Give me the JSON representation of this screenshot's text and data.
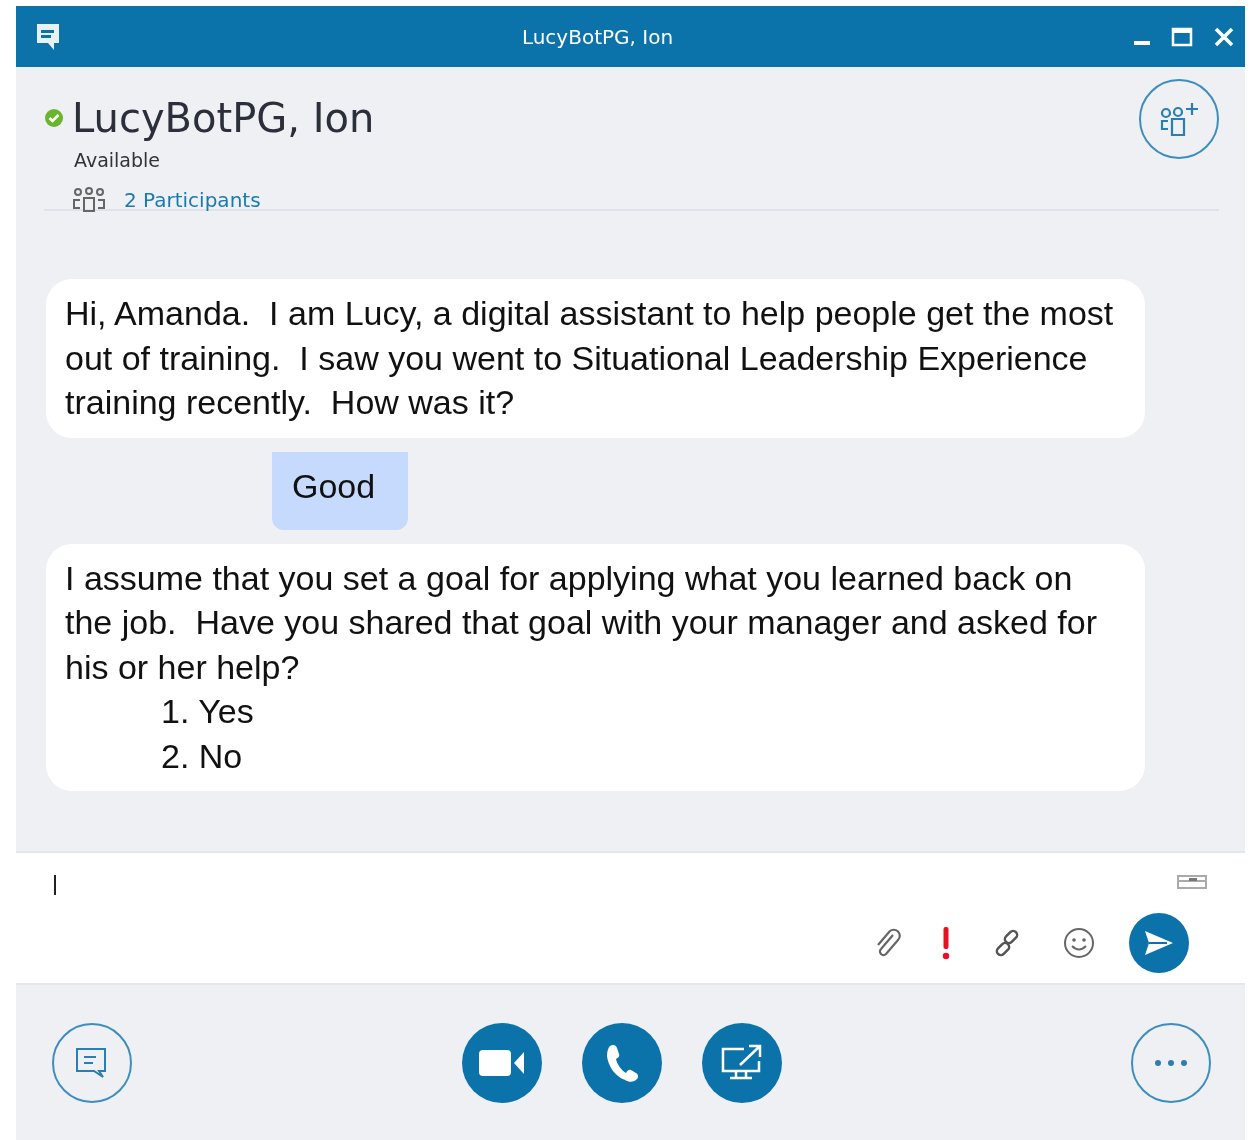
{
  "window": {
    "title": "LucyBotPG, Ion"
  },
  "contact": {
    "name": "LucyBotPG, Ion",
    "presence": "Available",
    "participants": "2 Participants"
  },
  "messages": [
    {
      "kind": "bot",
      "text": "Hi, Amanda.  I am Lucy, a digital assistant to help people get the most out of training.  I saw you went to Situational Leadership Experience training recently.  How was it?"
    },
    {
      "kind": "user",
      "text": "Good"
    },
    {
      "kind": "bot",
      "text": "I assume that you set a goal for applying what you learned back on the job.  Have you shared that goal with your manager and asked for his or her help?",
      "options": [
        "1. Yes",
        "2. No"
      ]
    }
  ]
}
